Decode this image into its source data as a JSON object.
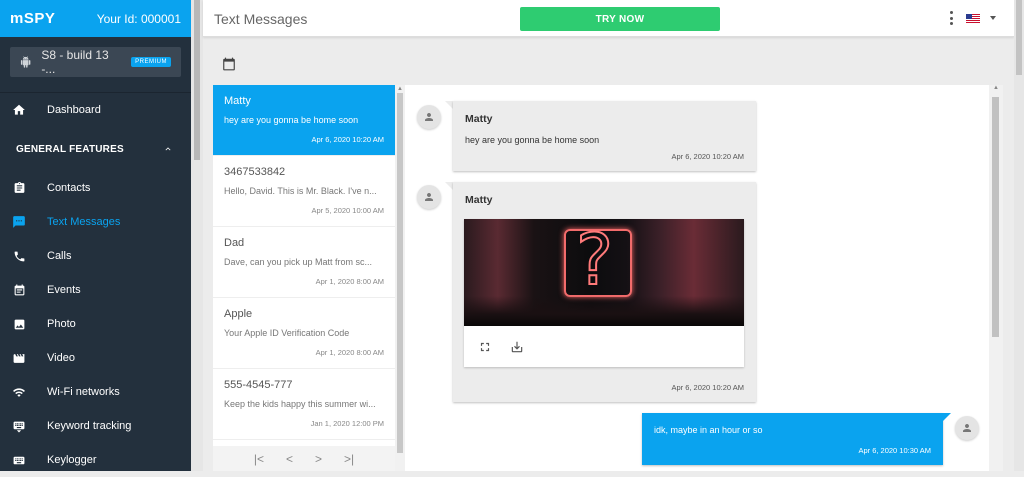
{
  "sidebar": {
    "logo": "mSPY",
    "your_id": "Your Id: 000001",
    "device": {
      "name": "S8 - build 13 -...",
      "badge": "PREMIUM"
    },
    "nav_top": [
      {
        "label": "Dashboard",
        "icon": "home-icon"
      }
    ],
    "section": {
      "label": "GENERAL FEATURES",
      "icon": "chevron-up-icon"
    },
    "nav": [
      {
        "label": "Contacts",
        "icon": "contacts-icon"
      },
      {
        "label": "Text Messages",
        "icon": "message-icon",
        "active": true
      },
      {
        "label": "Calls",
        "icon": "phone-icon"
      },
      {
        "label": "Events",
        "icon": "calendar-icon"
      },
      {
        "label": "Photo",
        "icon": "photo-icon"
      },
      {
        "label": "Video",
        "icon": "video-icon"
      },
      {
        "label": "Wi-Fi networks",
        "icon": "wifi-icon"
      },
      {
        "label": "Keyword tracking",
        "icon": "keyboard-icon"
      },
      {
        "label": "Keylogger",
        "icon": "keyboard-icon"
      }
    ]
  },
  "header": {
    "title": "Text Messages",
    "try_now": "TRY NOW",
    "language_icon": "us-flag-icon"
  },
  "conversations": [
    {
      "name": "Matty",
      "snippet": "hey are you gonna be home soon",
      "date": "Apr 6, 2020 10:20 AM",
      "active": true
    },
    {
      "name": "3467533842",
      "snippet": "Hello, David. This is Mr. Black. I've n...",
      "date": "Apr 5, 2020 10:00 AM"
    },
    {
      "name": "Dad",
      "snippet": "Dave, can you pick up Matt from sc...",
      "date": "Apr 1, 2020 8:00 AM"
    },
    {
      "name": "Apple",
      "snippet": "Your Apple ID Verification Code",
      "date": "Apr 1, 2020 8:00 AM"
    },
    {
      "name": "555-4545-777",
      "snippet": "Keep the kids happy this summer wi...",
      "date": "Jan 1, 2020 12:00 PM"
    }
  ],
  "pager": {
    "first": "|<",
    "prev": "<",
    "next": ">",
    "last": ">|"
  },
  "messages": [
    {
      "sender": "Matty",
      "text": "hey are you gonna be home soon",
      "date": "Apr 6, 2020 10:20 AM",
      "direction": "in"
    },
    {
      "sender": "Matty",
      "type": "photo",
      "date": "Apr 6, 2020 10:20 AM",
      "direction": "in"
    },
    {
      "text": "idk, maybe in an hour or so",
      "date": "Apr 6, 2020 10:30 AM",
      "direction": "out"
    }
  ],
  "colors": {
    "accent": "#0aa3ef",
    "sidebar": "#23303d",
    "try_now": "#2ecc71"
  }
}
